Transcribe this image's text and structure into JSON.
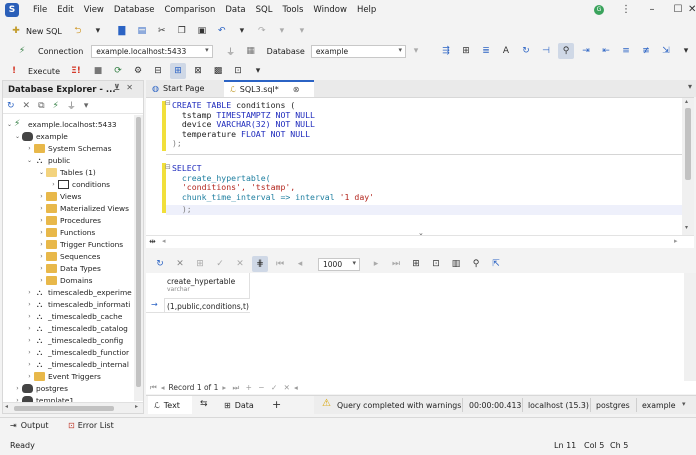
{
  "menu": [
    "File",
    "Edit",
    "View",
    "Database",
    "Comparison",
    "Data",
    "SQL",
    "Tools",
    "Window",
    "Help"
  ],
  "user_initial": "G",
  "toolbar1": {
    "new_sql": "New SQL"
  },
  "toolbar2": {
    "connection_label": "Connection",
    "connection_value": "example.localhost:5433",
    "database_label": "Database",
    "database_value": "example"
  },
  "toolbar3": {
    "execute": "Execute"
  },
  "explorer": {
    "title": "Database Explorer - ...",
    "nodes": [
      {
        "label": "example.localhost:5433"
      },
      {
        "label": "example"
      },
      {
        "label": "System Schemas"
      },
      {
        "label": "public"
      },
      {
        "label": "Tables (1)"
      },
      {
        "label": "conditions"
      },
      {
        "label": "Views"
      },
      {
        "label": "Materialized Views"
      },
      {
        "label": "Procedures"
      },
      {
        "label": "Functions"
      },
      {
        "label": "Trigger Functions"
      },
      {
        "label": "Sequences"
      },
      {
        "label": "Data Types"
      },
      {
        "label": "Domains"
      },
      {
        "label": "timescaledb_experime"
      },
      {
        "label": "timescaledb_informati"
      },
      {
        "label": "_timescaledb_cache"
      },
      {
        "label": "_timescaledb_catalog"
      },
      {
        "label": "_timescaledb_config"
      },
      {
        "label": "_timescaledb_functior"
      },
      {
        "label": "_timescaledb_internal"
      },
      {
        "label": "Event Triggers"
      },
      {
        "label": "postgres"
      },
      {
        "label": "template1"
      }
    ]
  },
  "tabs": [
    {
      "label": "Start Page"
    },
    {
      "label": "SQL3.sql*"
    }
  ],
  "code": {
    "l1a": "CREATE TABLE",
    "l1b": " conditions (",
    "l2a": "  tstamp ",
    "l2b": "TIMESTAMPTZ NOT NULL",
    "l3a": "  device ",
    "l3b": "VARCHAR(32) NOT NULL",
    "l4a": "  temperature ",
    "l4b": "FLOAT NOT NULL",
    "l5": ");",
    "l7": "SELECT",
    "l8": "  create_hypertable(",
    "l9": "  'conditions', 'tstamp',",
    "l10a": "  chunk_time_interval => interval ",
    "l10b": "'1 day'",
    "l11": "  );"
  },
  "results": {
    "page_size": "1000",
    "column_name": "create_hypertable",
    "column_type": "varchar",
    "row_value": "(1,public,conditions,t)",
    "record_nav": "Record 1 of 1"
  },
  "result_tabs": {
    "text": "Text",
    "data": "Data"
  },
  "status": {
    "message": "Query completed with warnings.",
    "time": "00:00:00.413",
    "host": "localhost (15.3)",
    "user": "postgres",
    "db": "example"
  },
  "bottom": {
    "output": "Output",
    "error_list": "Error List"
  },
  "statusbar": {
    "ready": "Ready",
    "ln": "Ln 11",
    "col": "Col 5",
    "ch": "Ch 5"
  }
}
